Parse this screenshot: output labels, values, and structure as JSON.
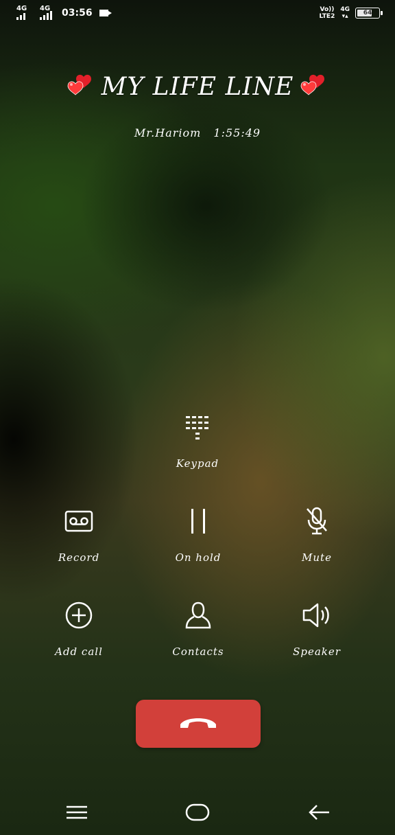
{
  "status_bar": {
    "sim1_network": "4G",
    "sim2_network": "4G",
    "time": "03:56",
    "volte_label_top": "Vo))",
    "volte_label_bottom": "LTE2",
    "data_network": "4G",
    "battery_level": "64",
    "icons": [
      "signal-icon",
      "video-record-icon",
      "battery-icon"
    ]
  },
  "call": {
    "caller_name": "MY LIFE LINE",
    "name_decoration": "two-hearts-emoji",
    "sub_name": "Mr.Hariom",
    "duration": "1:55:49"
  },
  "controls": {
    "keypad": {
      "label": "Keypad",
      "icon": "keypad-icon"
    },
    "record": {
      "label": "Record",
      "icon": "record-icon"
    },
    "hold": {
      "label": "On hold",
      "icon": "pause-icon"
    },
    "mute": {
      "label": "Mute",
      "icon": "mute-mic-icon"
    },
    "add_call": {
      "label": "Add call",
      "icon": "add-circle-icon"
    },
    "contacts": {
      "label": "Contacts",
      "icon": "contacts-icon"
    },
    "speaker": {
      "label": "Speaker",
      "icon": "speaker-icon"
    }
  },
  "end_call": {
    "icon": "hang-up-icon",
    "color": "#d2403a"
  },
  "nav": {
    "icons": [
      "menu-icon",
      "home-icon",
      "back-icon"
    ]
  }
}
